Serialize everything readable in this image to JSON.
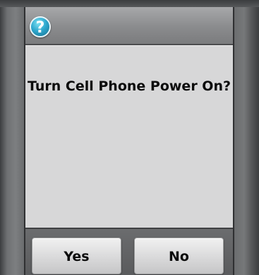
{
  "dialog": {
    "icon": "question-mark-icon",
    "icon_glyph": "?",
    "message": "Turn Cell Phone Power On?",
    "buttons": {
      "yes": "Yes",
      "no": "No"
    }
  },
  "colors": {
    "panel": "#d7d7d8",
    "icon_accent": "#2fa9cf",
    "text": "#0b0b0b"
  }
}
